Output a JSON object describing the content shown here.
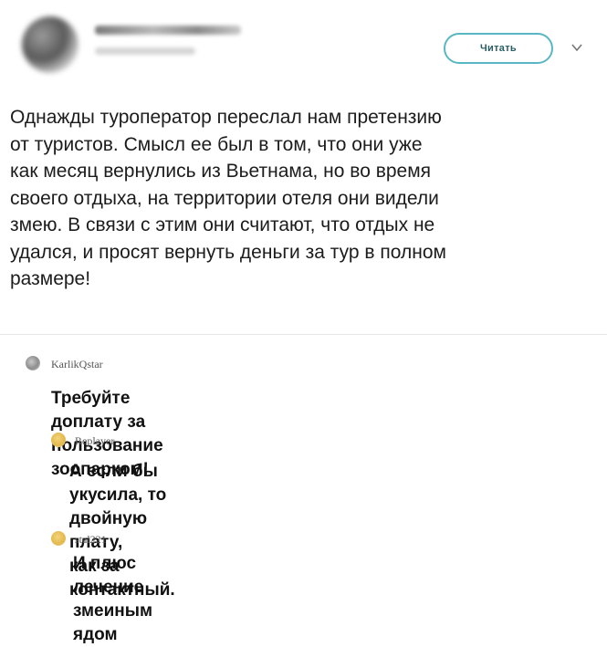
{
  "post": {
    "follow_label": "Читать",
    "text": "Однажды туроператор переслал нам претензию\nот туристов. Смысл ее был в том, что они уже\nкак месяц вернулись из Вьетнама, но во время\nсвоего отдыха, на территории отеля они видели\nзмею. В связи с этим они считают, что отдых не\nудался, и просят вернуть деньги за тур в полном\nразмере!"
  },
  "comments": [
    {
      "username": "KarlikQstar",
      "text": "Требуйте доплату за пользование зоопарком!"
    },
    {
      "username": "Replayer",
      "text": "А если бы укусила, то двойную плату,\nкак за контактный."
    },
    {
      "username": "stal221",
      "text": "И плюс лечение змеиным ядом"
    }
  ],
  "icons": {
    "more": "chevron-down-icon",
    "avatar_1": "planet-avatar",
    "avatar_2": "emoji-face-avatar",
    "avatar_3": "emoji-face-avatar"
  },
  "colors": {
    "follow_border": "#59b7c4",
    "text": "#1c1c1c"
  }
}
